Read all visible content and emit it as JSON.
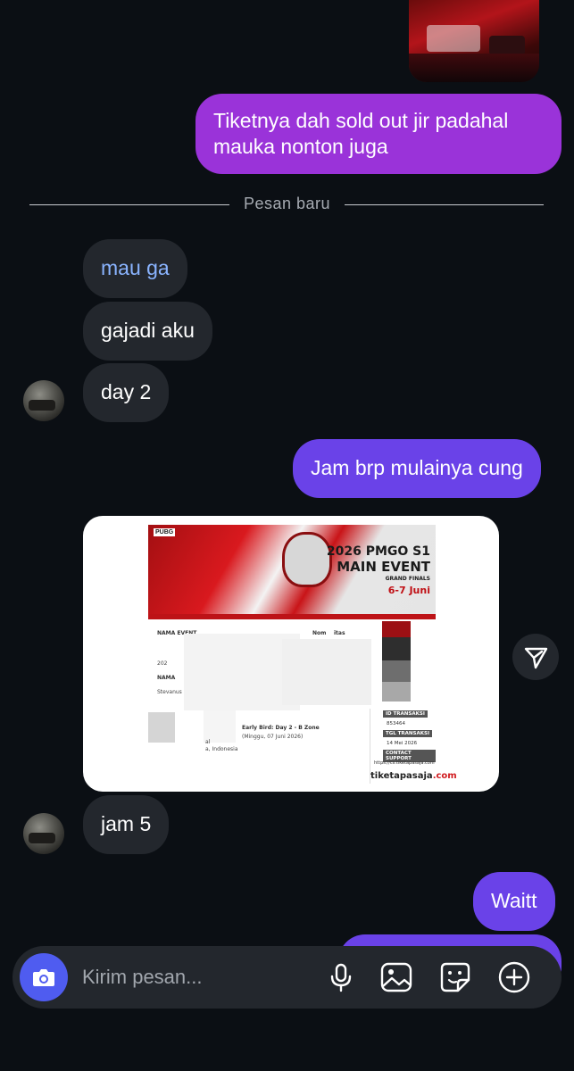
{
  "messages": {
    "out1": "Tiketnya dah sold out jir padahal mauka nonton juga",
    "divider": "Pesan baru",
    "in1": "mau ga",
    "in2": "gajadi aku",
    "in3": "day 2",
    "out2": "Jam brp mulainya cung",
    "in4": "jam 5",
    "out3": "Waitt"
  },
  "ticket": {
    "title_line1": "2026 PMGO S1",
    "title_line2": "MAIN EVENT",
    "title_line3": "GRAND FINALS",
    "title_line4": "6-7 Juni",
    "brand_prefix": "PUBG",
    "field_event": "NAMA EVENT",
    "field_name_short": "Nom",
    "field_name_suffix": "itas",
    "val_2026": "202",
    "field_nama": "NAMA",
    "val_nama": "Stevanus Indh",
    "ticket_type": "Early Bird: Day 2 - B Zone",
    "ticket_date": "(Minggu, 07 Juni 2026)",
    "ticket_loc_a": "al",
    "ticket_loc_b": "a, Indonesia",
    "id_label": "ID TRANSAKSI",
    "id_value": "853464",
    "date_label": "TGL TRANSAKSI",
    "date_value": "14 Mei 2026",
    "support_label": "CONTACT SUPPORT",
    "support_value": "https://cs.tiketapasaja.com",
    "brand_name": "tiketapasaja",
    "brand_tld": ".com"
  },
  "composer": {
    "placeholder": "Kirim pesan..."
  },
  "icons": [
    "camera-icon",
    "microphone-icon",
    "gallery-icon",
    "sticker-icon",
    "plus-icon",
    "share-icon"
  ],
  "colors": {
    "background": "#0b0f14",
    "incoming_bubble": "#23272d",
    "outgoing_purple": "#9a33d9",
    "outgoing_violet": "#6a42e8",
    "camera_button": "#4f5cf0",
    "link_text": "#8ab4ff"
  }
}
